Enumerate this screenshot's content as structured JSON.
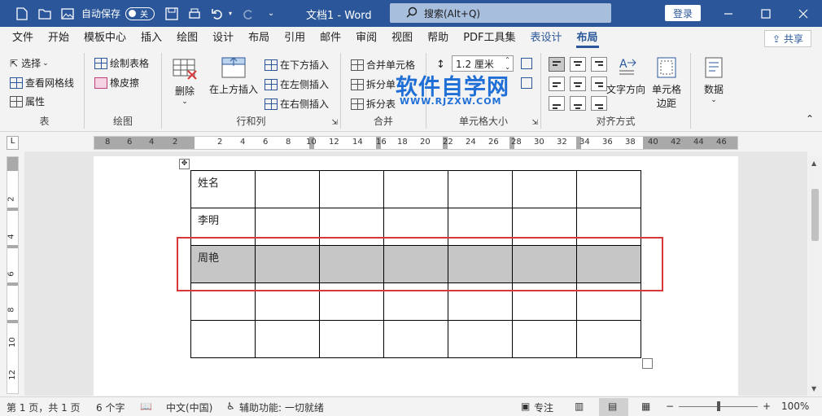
{
  "titlebar": {
    "autosave_label": "自动保存",
    "autosave_state": "关",
    "doc_name": "文档1 - Word",
    "search_placeholder": "搜索(Alt+Q)",
    "login_label": "登录"
  },
  "menu": {
    "items": [
      "文件",
      "开始",
      "模板中心",
      "插入",
      "绘图",
      "设计",
      "布局",
      "引用",
      "邮件",
      "审阅",
      "视图",
      "帮助",
      "PDF工具集",
      "表设计",
      "布局"
    ],
    "share_label": "共享"
  },
  "ribbon": {
    "table_group": {
      "select": "选择",
      "view_gridlines": "查看网格线",
      "properties": "属性",
      "label": "表"
    },
    "draw_group": {
      "draw_table": "绘制表格",
      "eraser": "橡皮擦",
      "label": "绘图"
    },
    "rows_cols_group": {
      "delete": "删除",
      "insert_above": "在上方插入",
      "insert_below": "在下方插入",
      "insert_left": "在左侧插入",
      "insert_right": "在右侧插入",
      "label": "行和列"
    },
    "merge_group": {
      "merge_cells": "合并单元格",
      "split_cells": "拆分单",
      "split_table": "拆分表",
      "label": "合并"
    },
    "cell_size_group": {
      "height_value": "1.2 厘米",
      "label": "单元格大小"
    },
    "alignment_group": {
      "text_direction": "文字方向",
      "cell_margins_line1": "单元格",
      "cell_margins_line2": "边距",
      "label": "对齐方式"
    },
    "data_group": {
      "data": "数据"
    }
  },
  "watermark": {
    "main": "软件自学网",
    "sub": "WWW.RJZXW.COM"
  },
  "ruler": {
    "h_numbers": [
      "8",
      "6",
      "4",
      "2",
      "2",
      "4",
      "6",
      "8",
      "10",
      "12",
      "14",
      "16",
      "18",
      "20",
      "22",
      "24",
      "26",
      "28",
      "30",
      "32",
      "34",
      "36",
      "38",
      "40",
      "42",
      "44",
      "46"
    ],
    "v_numbers": [
      "2",
      "4",
      "6",
      "8",
      "10",
      "12"
    ]
  },
  "table": {
    "rows": [
      [
        "姓名",
        "",
        "",
        "",
        "",
        "",
        ""
      ],
      [
        "李明",
        "",
        "",
        "",
        "",
        "",
        ""
      ],
      [
        "周艳",
        "",
        "",
        "",
        "",
        "",
        ""
      ],
      [
        "",
        "",
        "",
        "",
        "",
        "",
        ""
      ],
      [
        "",
        "",
        "",
        "",
        "",
        "",
        ""
      ]
    ]
  },
  "statusbar": {
    "page_info": "第 1 页，共 1 页",
    "word_count": "6 个字",
    "language": "中文(中国)",
    "accessibility": "辅助功能: 一切就绪",
    "focus": "专注",
    "zoom": "100%"
  },
  "colors": {
    "accent": "#2b579a",
    "highlight_box": "#d9383a",
    "selection": "#c6c6c6"
  }
}
